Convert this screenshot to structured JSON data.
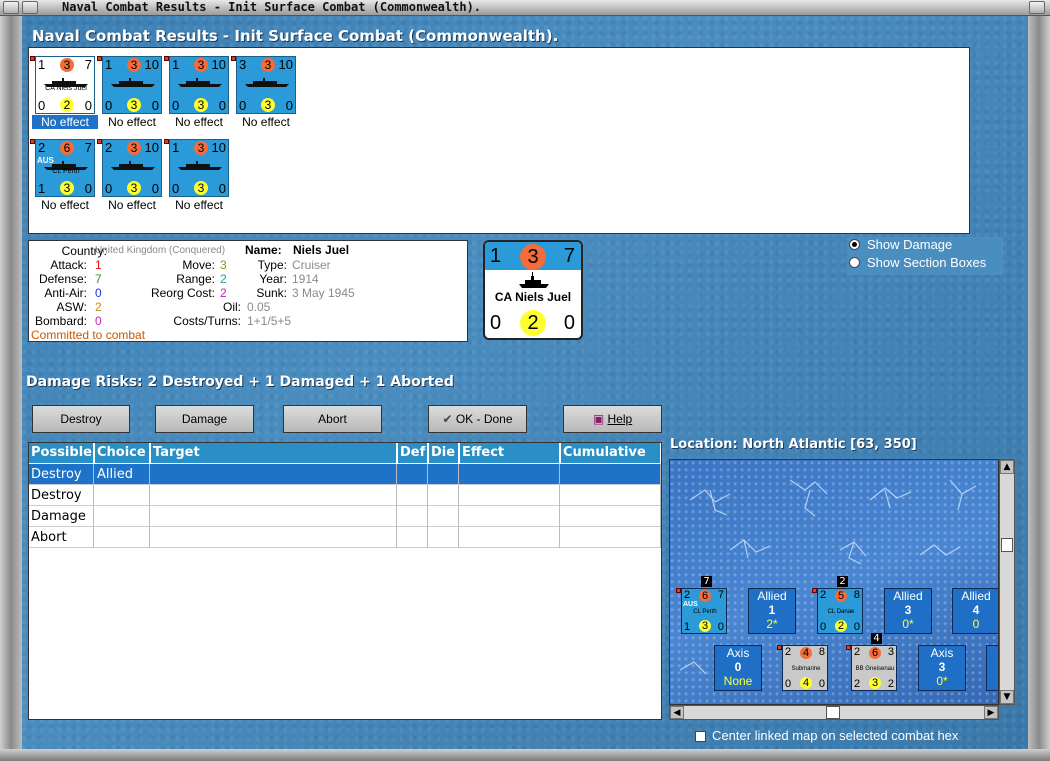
{
  "window": {
    "title": "Naval Combat Results - Init Surface Combat (Commonwealth)."
  },
  "header": {
    "title": "Naval Combat Results - Init Surface Combat (Commonwealth)."
  },
  "counters": [
    {
      "top_left": "1",
      "mid": "3",
      "top_right": "7",
      "name": "CA Niels Juel",
      "bottom_left": "0",
      "bottom_mid": "2",
      "bottom_right": "0",
      "label": "No effect",
      "selected": true
    },
    {
      "top_left": "1",
      "mid": "3",
      "top_right": "10",
      "name": "",
      "bottom_left": "0",
      "bottom_mid": "3",
      "bottom_right": "0",
      "label": "No effect"
    },
    {
      "top_left": "1",
      "mid": "3",
      "top_right": "10",
      "name": "",
      "bottom_left": "0",
      "bottom_mid": "3",
      "bottom_right": "0",
      "label": "No effect"
    },
    {
      "top_left": "3",
      "mid": "3",
      "top_right": "10",
      "name": "",
      "bottom_left": "0",
      "bottom_mid": "3",
      "bottom_right": "0",
      "label": "No effect"
    },
    {
      "top_left": "2",
      "mid": "6",
      "top_right": "7",
      "name": "CL Perth",
      "flag": "AUS",
      "bottom_left": "1",
      "bottom_mid": "3",
      "bottom_right": "0",
      "label": "No effect"
    },
    {
      "top_left": "2",
      "mid": "3",
      "top_right": "10",
      "name": "",
      "bottom_left": "0",
      "bottom_mid": "3",
      "bottom_right": "0",
      "label": "No effect"
    },
    {
      "top_left": "1",
      "mid": "3",
      "top_right": "10",
      "name": "",
      "bottom_left": "0",
      "bottom_mid": "3",
      "bottom_right": "0",
      "label": "No effect"
    }
  ],
  "info": {
    "country_label": "Country:",
    "country_value": "United Kingdom (Conquered)",
    "attack_label": "Attack:",
    "attack_value": "1",
    "defense_label": "Defense:",
    "defense_value": "7",
    "antiair_label": "Anti-Air:",
    "antiair_value": "0",
    "asw_label": "ASW:",
    "asw_value": "2",
    "bombard_label": "Bombard:",
    "bombard_value": "0",
    "committed": "Committed to combat",
    "name_label": "Name:",
    "name_value": "Niels Juel",
    "move_label": "Move:",
    "move_value": "3",
    "range_label": "Range:",
    "range_value": "2",
    "reorg_label": "Reorg Cost:",
    "reorg_value": "2",
    "oil_label": "Oil:",
    "oil_value": "0.05",
    "costs_label": "Costs/Turns:",
    "costs_value": "1+1/5+5",
    "type_label": "Type:",
    "type_value": "Cruiser",
    "year_label": "Year:",
    "year_value": "1914",
    "sunk_label": "Sunk:",
    "sunk_value": "3 May 1945"
  },
  "big_counter": {
    "top_left": "1",
    "mid": "3",
    "top_right": "7",
    "name": "CA Niels Juel",
    "bottom_left": "0",
    "bottom_mid": "2",
    "bottom_right": "0"
  },
  "options": {
    "show_damage": "Show Damage",
    "show_section_boxes": "Show Section Boxes"
  },
  "damage_risks": "Damage Risks:  2 Destroyed + 1 Damaged + 1 Aborted",
  "buttons": {
    "destroy": "Destroy",
    "damage": "Damage",
    "abort": "Abort",
    "ok": "OK - Done",
    "help": "Help"
  },
  "location": "Location:  North Atlantic [63, 350]",
  "table": {
    "headers": [
      "Possible",
      "Choice",
      "Target",
      "Def",
      "Die",
      "Effect",
      "Cumulative"
    ],
    "rows": [
      [
        "Destroy",
        "Allied",
        "",
        "",
        "",
        "",
        ""
      ],
      [
        "Destroy",
        "",
        "",
        "",
        "",
        "",
        ""
      ],
      [
        "Damage",
        "",
        "",
        "",
        "",
        "",
        ""
      ],
      [
        "Abort",
        "",
        "",
        "",
        "",
        "",
        ""
      ]
    ]
  },
  "map": {
    "allied_boxes": [
      {
        "side": "Allied",
        "num": "1",
        "sub": "2*"
      },
      {
        "side": "Allied",
        "num": "3",
        "sub": "0*"
      },
      {
        "side": "Allied",
        "num": "4",
        "sub": "0"
      }
    ],
    "axis_boxes": [
      {
        "side": "Axis",
        "num": "0",
        "sub": "None"
      },
      {
        "side": "Axis",
        "num": "3",
        "sub": "0*"
      }
    ],
    "units": [
      {
        "tl": "2",
        "mid": "6",
        "tr": "7",
        "name": "CL Perth",
        "flag": "AUS",
        "bl": "1",
        "bm": "3",
        "br": "0",
        "stack": "7"
      },
      {
        "tl": "2",
        "mid": "5",
        "tr": "8",
        "name": "CL Danae",
        "bl": "0",
        "bm": "2",
        "br": "0",
        "stack": "2"
      },
      {
        "tl": "2",
        "mid": "4",
        "tr": "8",
        "name": "Submarine",
        "bl": "0",
        "bm": "4",
        "br": "0"
      },
      {
        "tl": "2",
        "mid": "6",
        "tr": "3",
        "name": "BB Gneisenau",
        "bl": "2",
        "bm": "3",
        "br": "2",
        "stack": "4"
      }
    ]
  },
  "center_map_label": "Center linked map on selected combat hex",
  "colors": {
    "orange_text": "#c85a00",
    "red": "#e81010",
    "green": "#2b9a2b",
    "blue": "#1a3ad8",
    "olive": "#9a8a10",
    "purple": "#c020c0",
    "grey": "#8a8a8a"
  }
}
